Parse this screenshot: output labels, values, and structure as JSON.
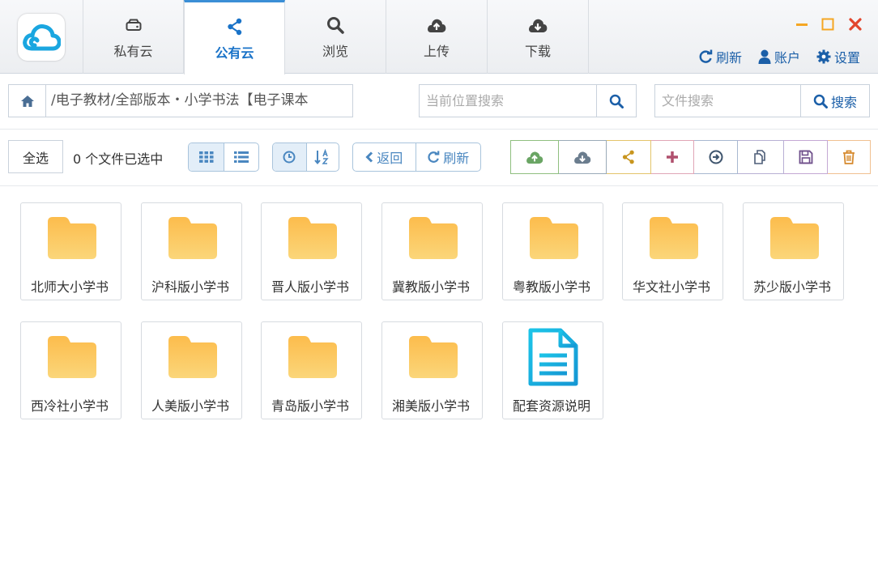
{
  "tabs": [
    {
      "label": "私有云",
      "icon": "hdd-icon"
    },
    {
      "label": "公有云",
      "icon": "share-icon"
    },
    {
      "label": "浏览",
      "icon": "search-icon"
    },
    {
      "label": "上传",
      "icon": "cloud-upload-icon"
    },
    {
      "label": "下载",
      "icon": "cloud-download-icon"
    }
  ],
  "active_tab": 1,
  "top_links": {
    "refresh": "刷新",
    "account": "账户",
    "settings": "设置"
  },
  "path": {
    "text": "/电子教材/全部版本・小学书法【电子课本"
  },
  "location_search": {
    "placeholder": "当前位置搜索"
  },
  "file_search": {
    "placeholder": "文件搜索",
    "button": "搜索"
  },
  "toolbar": {
    "select_all": "全选",
    "selected_count": "0 个文件已选中",
    "back": "返回",
    "refresh": "刷新"
  },
  "files": [
    {
      "name": "北师大小学书",
      "type": "folder"
    },
    {
      "name": "沪科版小学书",
      "type": "folder"
    },
    {
      "name": "晋人版小学书",
      "type": "folder"
    },
    {
      "name": "冀教版小学书",
      "type": "folder"
    },
    {
      "name": "粤教版小学书",
      "type": "folder"
    },
    {
      "name": "华文社小学书",
      "type": "folder"
    },
    {
      "name": "苏少版小学书",
      "type": "folder"
    },
    {
      "name": "西冷社小学书",
      "type": "folder"
    },
    {
      "name": "人美版小学书",
      "type": "folder"
    },
    {
      "name": "青岛版小学书",
      "type": "folder"
    },
    {
      "name": "湘美版小学书",
      "type": "folder"
    },
    {
      "name": "配套资源说明",
      "type": "document"
    }
  ],
  "colors": {
    "accent": "#1a73c8",
    "folder": "#fcc45a",
    "document": "#1ab0de",
    "minimize": "#f5a623",
    "maximize": "#f5a623",
    "close": "#e2452c"
  }
}
